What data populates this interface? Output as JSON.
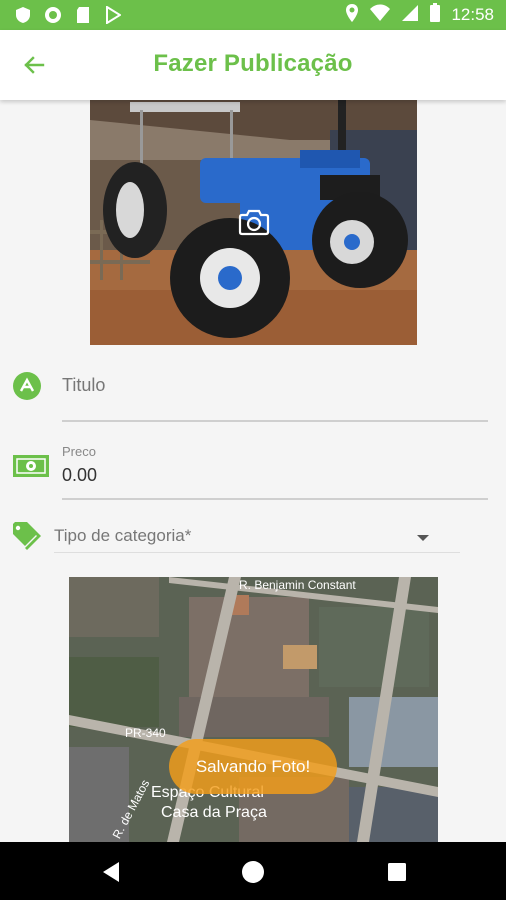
{
  "status_bar": {
    "time": "12:58",
    "left_icons": [
      "shield-icon",
      "circle-icon",
      "sd-card-icon",
      "play-store-icon"
    ],
    "right_icons": [
      "location-icon",
      "wifi-icon",
      "signal-icon",
      "battery-icon"
    ]
  },
  "app_bar": {
    "title": "Fazer Publicação",
    "back_icon": "arrow-left-icon"
  },
  "form": {
    "title_field": {
      "placeholder": "Titulo",
      "icon": "title-icon"
    },
    "price_field": {
      "label": "Preco",
      "value": "0.00",
      "icon": "money-icon"
    },
    "category_field": {
      "placeholder": "Tipo de categoria*",
      "icon": "tag-icon"
    }
  },
  "map": {
    "street_labels": [
      "R. Benjamin Constant",
      "PR-340",
      "Espaço Cultural",
      "Casa da Praça",
      "R. de Matos"
    ],
    "status_text": "Salvando Foto!"
  },
  "colors": {
    "accent": "#6cc04a",
    "saving_pill": "#f49d1a",
    "nav_bar": "#000000"
  },
  "nav_bar": {
    "icons": [
      "back-triangle-icon",
      "home-circle-icon",
      "recents-square-icon"
    ]
  }
}
